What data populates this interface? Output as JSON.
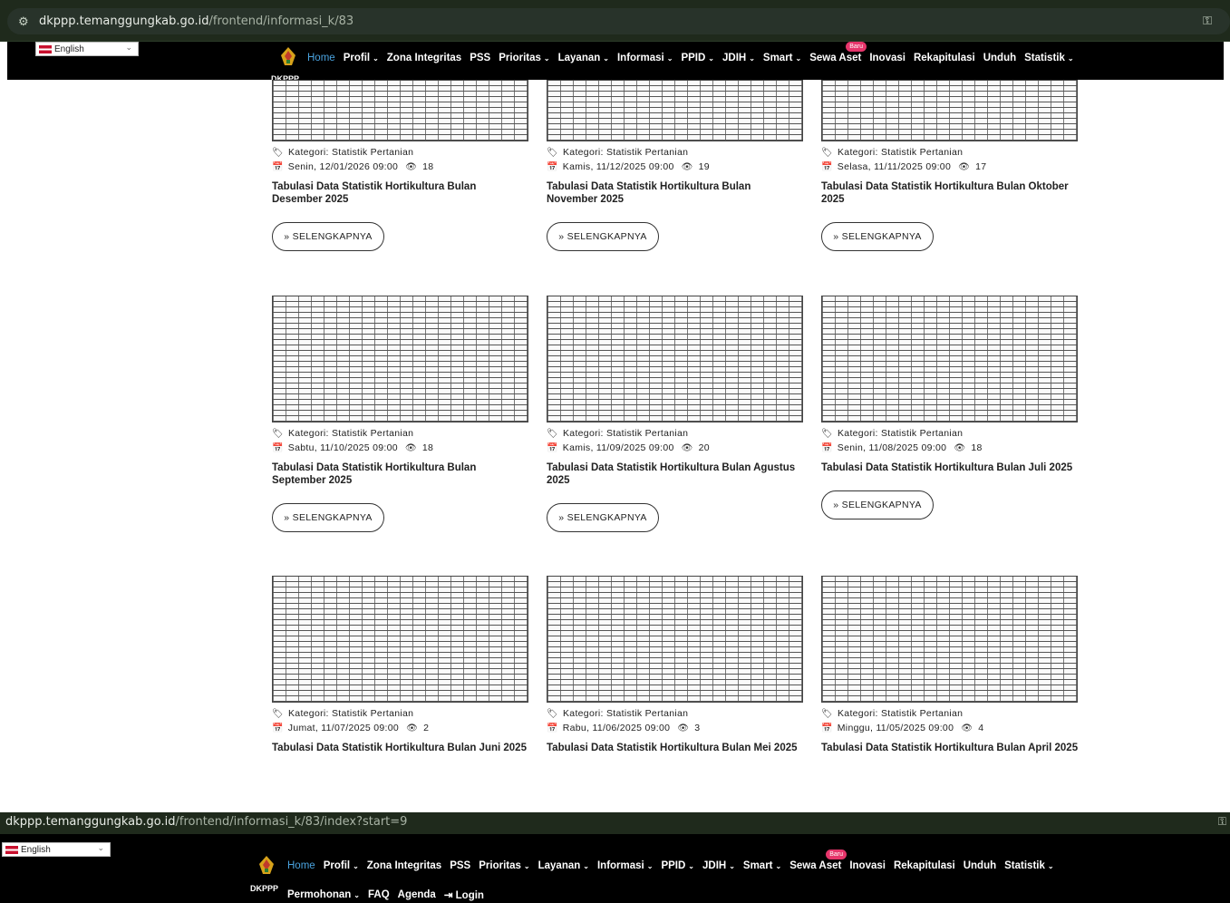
{
  "browser_top": {
    "domain": "dkppp.temanggungkab.go.id",
    "path": "/frontend/informasi_k/83"
  },
  "browser_bottom": {
    "domain": "dkppp.temanggungkab.go.id",
    "path": "/frontend/informasi_k/83/index?start=9"
  },
  "language": "English",
  "site_name": "DKPPP",
  "nav": {
    "home": "Home",
    "profil": "Profil",
    "zona": "Zona Integritas",
    "pss": "PSS",
    "prioritas": "Prioritas",
    "layanan": "Layanan",
    "informasi": "Informasi",
    "ppid": "PPID",
    "jdih": "JDIH",
    "smart": "Smart",
    "sewa": "Sewa Aset",
    "baru": "Baru",
    "inovasi": "Inovasi",
    "rekap": "Rekapitulasi",
    "unduh": "Unduh",
    "statistik": "Statistik",
    "permohonan": "Permohonan",
    "faq": "FAQ",
    "agenda": "Agenda",
    "login": "Login"
  },
  "more_label": "» SELENGKAPNYA",
  "cards": [
    {
      "category": "Kategori: Statistik Pertanian",
      "date": "Senin, 12/01/2026 09:00",
      "views": "18",
      "title": "Tabulasi Data Statistik Hortikultura Bulan Desember 2025"
    },
    {
      "category": "Kategori: Statistik Pertanian",
      "date": "Kamis, 11/12/2025 09:00",
      "views": "19",
      "title": "Tabulasi Data Statistik Hortikultura Bulan November 2025"
    },
    {
      "category": "Kategori: Statistik Pertanian",
      "date": "Selasa, 11/11/2025 09:00",
      "views": "17",
      "title": "Tabulasi Data Statistik Hortikultura Bulan Oktober 2025"
    },
    {
      "category": "Kategori: Statistik Pertanian",
      "date": "Sabtu, 11/10/2025 09:00",
      "views": "18",
      "title": "Tabulasi Data Statistik Hortikultura Bulan September 2025"
    },
    {
      "category": "Kategori: Statistik Pertanian",
      "date": "Kamis, 11/09/2025 09:00",
      "views": "20",
      "title": "Tabulasi Data Statistik Hortikultura Bulan Agustus 2025"
    },
    {
      "category": "Kategori: Statistik Pertanian",
      "date": "Senin, 11/08/2025 09:00",
      "views": "18",
      "title": "Tabulasi Data Statistik Hortikultura Bulan Juli 2025"
    },
    {
      "category": "Kategori: Statistik Pertanian",
      "date": "Jumat, 11/07/2025 09:00",
      "views": "2",
      "title": "Tabulasi Data Statistik Hortikultura Bulan Juni 2025"
    },
    {
      "category": "Kategori: Statistik Pertanian",
      "date": "Rabu, 11/06/2025 09:00",
      "views": "3",
      "title": "Tabulasi Data Statistik Hortikultura Bulan Mei 2025"
    },
    {
      "category": "Kategori: Statistik Pertanian",
      "date": "Minggu, 11/05/2025 09:00",
      "views": "4",
      "title": "Tabulasi Data Statistik Hortikultura Bulan April 2025"
    }
  ]
}
